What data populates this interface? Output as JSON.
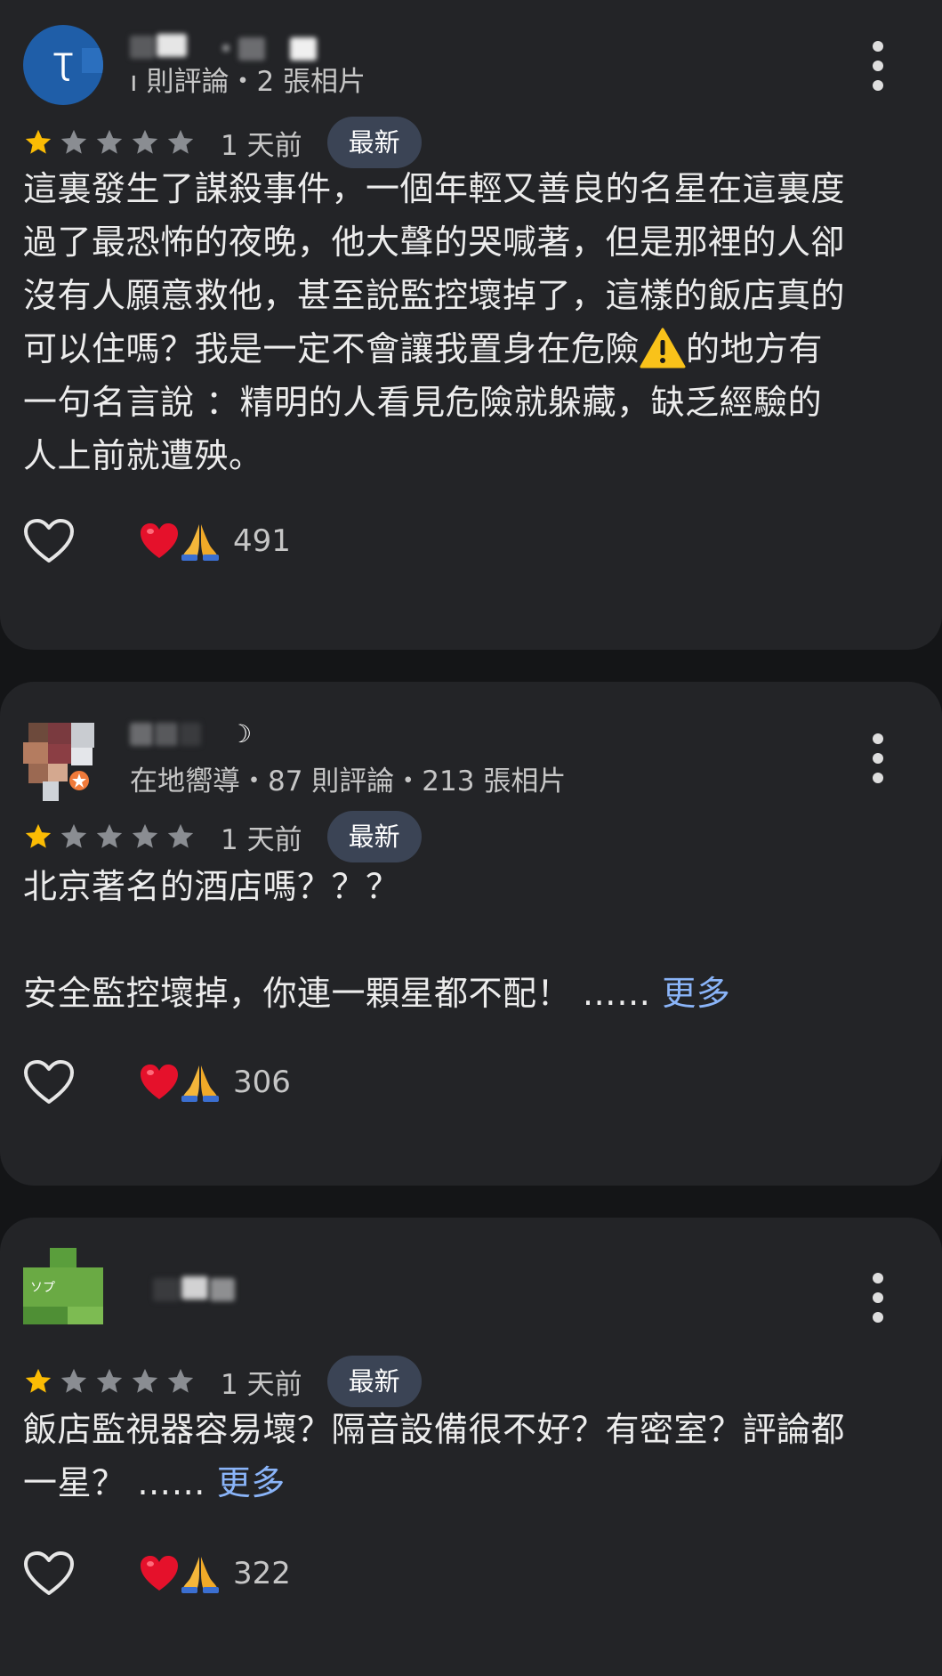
{
  "reviews": [
    {
      "author_meta": "ı 則評論・2 張相片",
      "avatar_letter": "Ʈ",
      "rating": 1,
      "max_rating": 5,
      "time": "1 天前",
      "badge": "最新",
      "lines": [
        "這裏發生了謀殺事件，一個年輕又善良的名星在這裏度",
        "過了最恐怖的夜晚，他大聲的哭喊著，但是那裡的人卻",
        "沒有人願意救他，甚至說監控壞掉了，這樣的飯店真的"
      ],
      "line4_before": "可以住嗎？我是一定不會讓我置身在危險",
      "line4_after": "的地方有",
      "lines_end": [
        "一句名言說 ：精明的人看見危險就躲藏，缺乏經驗的",
        "人上前就遭殃。"
      ],
      "reaction_count": "491"
    },
    {
      "author_name_fragment": "☽",
      "author_meta": "在地嚮導・87 則評論・213 張相片",
      "rating": 1,
      "max_rating": 5,
      "time": "1 天前",
      "badge": "最新",
      "line1": "北京著名的酒店嗎？？？",
      "line2": "安全監控壞掉，你連一顆星都不配！ ……",
      "more_label": "更多",
      "reaction_count": "306"
    },
    {
      "avatar_text": "ソプ",
      "rating": 1,
      "max_rating": 5,
      "time": "1 天前",
      "badge": "最新",
      "line1": "飯店監視器容易壞？隔音設備很不好？有密室？評論都",
      "line2": "一星？ ……",
      "more_label": "更多",
      "reaction_count": "322"
    }
  ],
  "colors": {
    "background": "#141517",
    "card": "#232427",
    "star_filled": "#fbbc04",
    "star_empty": "#8a8d92",
    "badge_bg": "#3b4455",
    "link": "#8ab4f8"
  },
  "icons": {
    "more": "more-vert-icon",
    "like": "heart-outline-icon",
    "reactions": [
      "red-heart-emoji",
      "folded-hands-emoji"
    ],
    "warning": "warning-emoji"
  }
}
